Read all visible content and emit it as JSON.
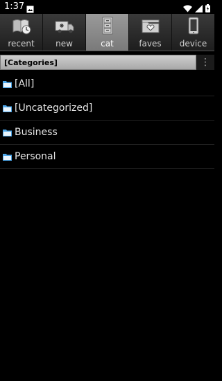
{
  "status_bar": {
    "time": "1:37",
    "icons": [
      "image-icon",
      "wifi-icon",
      "signal-icon",
      "battery-icon"
    ]
  },
  "tabs": [
    {
      "label": "recent",
      "icon": "book-clock-icon",
      "active": false
    },
    {
      "label": "new",
      "icon": "truck-icon",
      "active": false
    },
    {
      "label": "cat",
      "icon": "filing-cabinet-icon",
      "active": true
    },
    {
      "label": "faves",
      "icon": "heart-folder-icon",
      "active": false
    },
    {
      "label": "device",
      "icon": "device-icon",
      "active": false
    }
  ],
  "header": {
    "title": "[Categories]",
    "menu_icon": "overflow-menu-icon"
  },
  "categories": [
    {
      "label": "[All]"
    },
    {
      "label": "[Uncategorized]"
    },
    {
      "label": "Business"
    },
    {
      "label": "Personal"
    }
  ],
  "colors": {
    "background": "#000000",
    "tab_active": "#8a8a8a",
    "folder": "#4da6e8"
  }
}
